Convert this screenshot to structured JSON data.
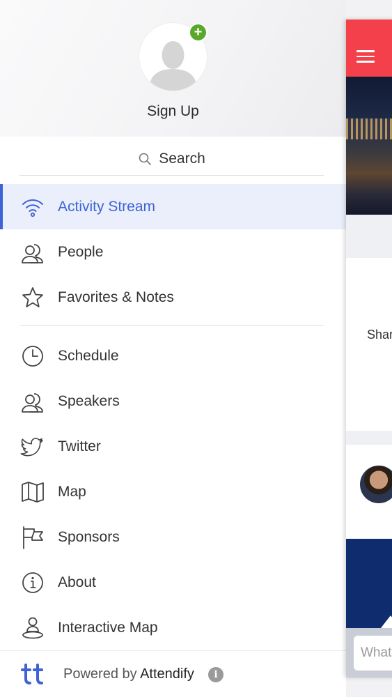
{
  "drawer": {
    "signup_label": "Sign Up",
    "add_badge": "+",
    "search_label": "Search",
    "menu_primary": [
      {
        "label": "Activity Stream",
        "icon": "wifi-icon",
        "active": true
      },
      {
        "label": "People",
        "icon": "people-icon"
      },
      {
        "label": "Favorites & Notes",
        "icon": "star-icon"
      }
    ],
    "menu_secondary": [
      {
        "label": "Schedule",
        "icon": "clock-icon"
      },
      {
        "label": "Speakers",
        "icon": "speakers-icon"
      },
      {
        "label": "Twitter",
        "icon": "twitter-icon"
      },
      {
        "label": "Map",
        "icon": "map-icon"
      },
      {
        "label": "Sponsors",
        "icon": "flag-icon"
      },
      {
        "label": "About",
        "icon": "info-icon"
      },
      {
        "label": "Interactive Map",
        "icon": "map-pin-person-icon"
      }
    ],
    "footer": {
      "logo_text": "tt",
      "powered_prefix": "Powered by ",
      "powered_brand": "Attendify",
      "info_glyph": "i"
    }
  },
  "preview": {
    "share_text": "Shar",
    "composer_placeholder": "What"
  },
  "colors": {
    "accent": "#3d63d6",
    "active_bg": "#eaeffb",
    "header_red": "#f4404a",
    "badge_green": "#5aa82a"
  }
}
